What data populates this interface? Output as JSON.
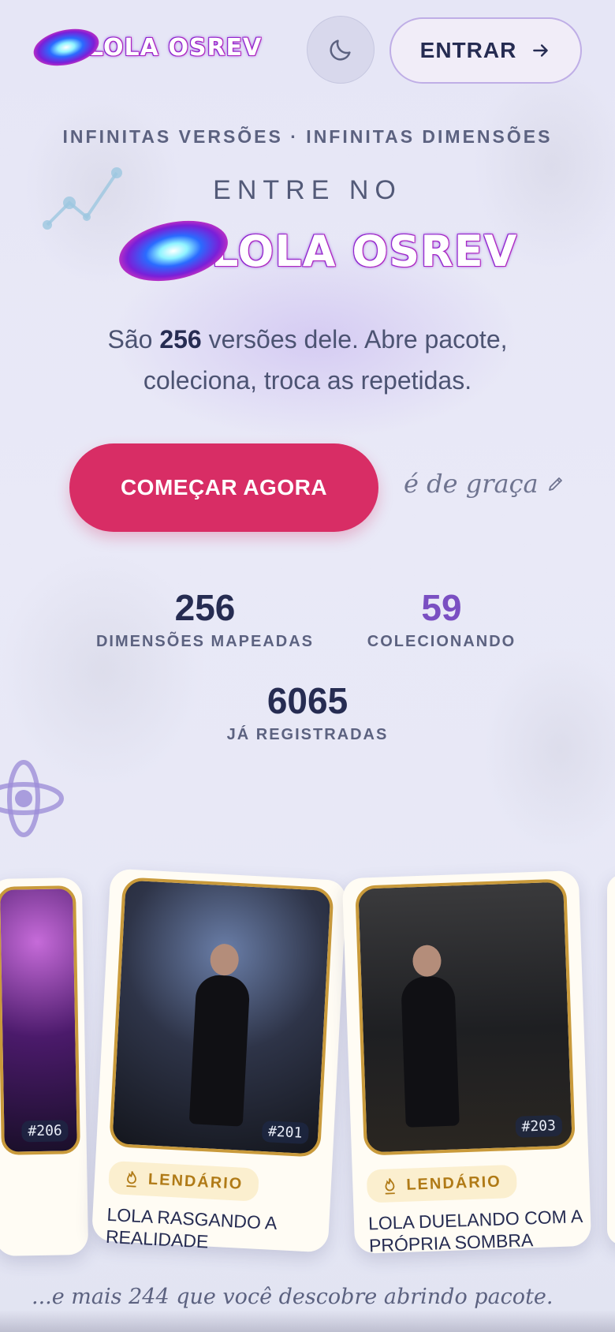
{
  "header": {
    "logo_text": "LOLA OSREV",
    "login_label": "ENTRAR"
  },
  "hero": {
    "tagline": "INFINITAS VERSÕES · INFINITAS DIMENSÕES",
    "enter_label": "ENTRE NO",
    "logo_text": "LOLA OSREV",
    "lead_prefix": "São ",
    "lead_count": "256",
    "lead_line1_suffix": " versões dele. Abre pacote,",
    "lead_line2": "coleciona, troca as repetidas.",
    "cta_label": "COMEÇAR AGORA",
    "free_note": "é de graça"
  },
  "stats": [
    {
      "value": "256",
      "label": "DIMENSÕES MAPEADAS"
    },
    {
      "value": "59",
      "label": "COLECIONANDO"
    },
    {
      "value": "6065",
      "label": "JÁ REGISTRADAS"
    }
  ],
  "cards": [
    {
      "number": "#206"
    },
    {
      "number": "#201",
      "rarity": "LENDÁRIO",
      "title_line1": "LOLA RASGANDO A",
      "title_line2": "REALIDADE"
    },
    {
      "number": "#203",
      "rarity": "LENDÁRIO",
      "title_line1": "LOLA DUELANDO COM A",
      "title_line2": "PRÓPRIA SOMBRA"
    }
  ],
  "more_note": "...e mais 244 que você descobre abrindo pacote.",
  "colors": {
    "accent": "#d82d65",
    "purple": "#7a4fc2",
    "gold": "#c99a3b",
    "text_dark": "#262c52"
  },
  "icons": [
    "moon-icon",
    "arrow-right-icon",
    "pencil-icon",
    "flame-icon",
    "atom-icon",
    "chart-deco-icon"
  ]
}
